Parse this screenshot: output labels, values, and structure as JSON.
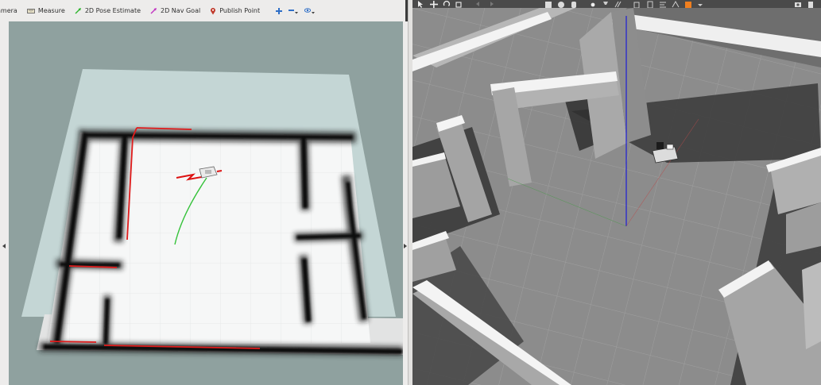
{
  "rviz": {
    "toolbar": {
      "camera_label": "amera",
      "measure_label": "Measure",
      "pose_estimate_label": "2D Pose Estimate",
      "nav_goal_label": "2D Nav Goal",
      "publish_point_label": "Publish Point"
    },
    "colors": {
      "pose_estimate_accent": "#2fb52f",
      "nav_goal_accent": "#c235c2",
      "publish_point_accent": "#c0392b",
      "laser_scan": "#e01b1b",
      "planned_path": "#35c23a",
      "viewport_background": "#8fa19f"
    }
  },
  "gazebo": {
    "colors": {
      "ground": "#8c8c8c",
      "wall_top": "#f2f2f2",
      "wall_side": "#9a9a9a",
      "z_axis": "#1d1dd6",
      "record_accent": "#f07f1f"
    }
  }
}
